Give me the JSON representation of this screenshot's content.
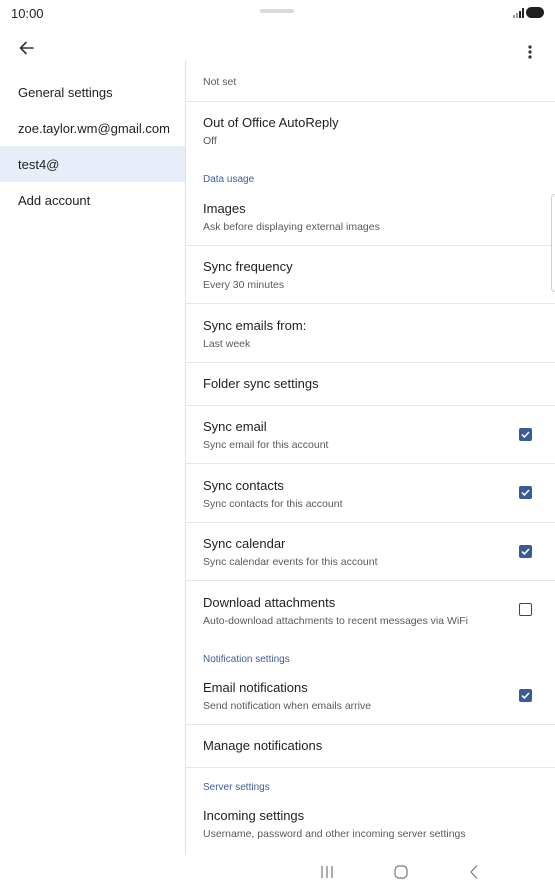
{
  "status": {
    "time": "10:00"
  },
  "toolbar": {
    "back_icon": "arrow-back-icon",
    "more_icon": "more-vert-icon"
  },
  "sidebar": {
    "items": [
      {
        "label": "General settings"
      },
      {
        "label": "zoe.taylor.wm@gmail.com"
      },
      {
        "label": "test4@",
        "selected": true
      },
      {
        "label": "Add account"
      }
    ]
  },
  "settings": {
    "partial_top": {
      "sub": "Not set"
    },
    "out_of_office": {
      "title": "Out of Office AutoReply",
      "sub": "Off"
    },
    "data_usage_label": "Data usage",
    "images": {
      "title": "Images",
      "sub": "Ask before displaying external images"
    },
    "sync_frequency": {
      "title": "Sync frequency",
      "sub": "Every 30 minutes"
    },
    "sync_emails_from": {
      "title": "Sync emails from:",
      "sub": "Last week"
    },
    "folder_sync": {
      "title": "Folder sync settings"
    },
    "sync_email": {
      "title": "Sync email",
      "sub": "Sync email for this account",
      "checked": true
    },
    "sync_contacts": {
      "title": "Sync contacts",
      "sub": "Sync contacts for this account",
      "checked": true
    },
    "sync_calendar": {
      "title": "Sync calendar",
      "sub": "Sync calendar events for this account",
      "checked": true
    },
    "download_attachments": {
      "title": "Download attachments",
      "sub": "Auto-download attachments to recent messages via WiFi",
      "checked": false
    },
    "notification_label": "Notification settings",
    "email_notifications": {
      "title": "Email notifications",
      "sub": "Send notification when emails arrive",
      "checked": true
    },
    "manage_notifications": {
      "title": "Manage notifications"
    },
    "server_label": "Server settings",
    "incoming": {
      "title": "Incoming settings",
      "sub": "Username, password and other incoming server settings"
    }
  },
  "colors": {
    "accent": "#3a5a99",
    "section": "#3f5e98",
    "selected_bg": "#e8eef9"
  }
}
